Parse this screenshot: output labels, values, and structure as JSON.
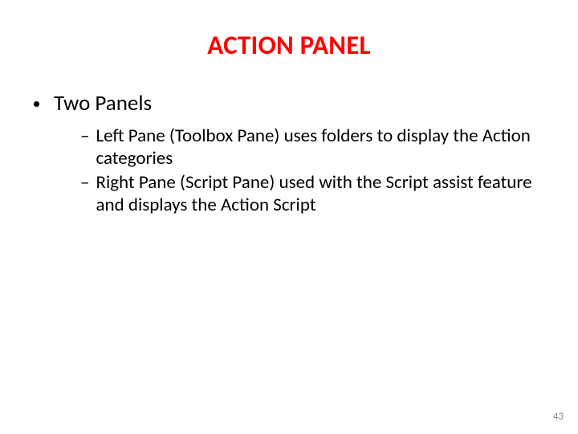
{
  "title": "ACTION PANEL",
  "bullets": {
    "level1": [
      {
        "text": "Two Panels"
      }
    ],
    "level2": [
      {
        "text": "Left Pane (Toolbox Pane) uses folders to display the Action categories"
      },
      {
        "text": "Right Pane (Script Pane) used with the Script assist feature and displays the Action Script"
      }
    ]
  },
  "dash": "–",
  "page_number": "43"
}
